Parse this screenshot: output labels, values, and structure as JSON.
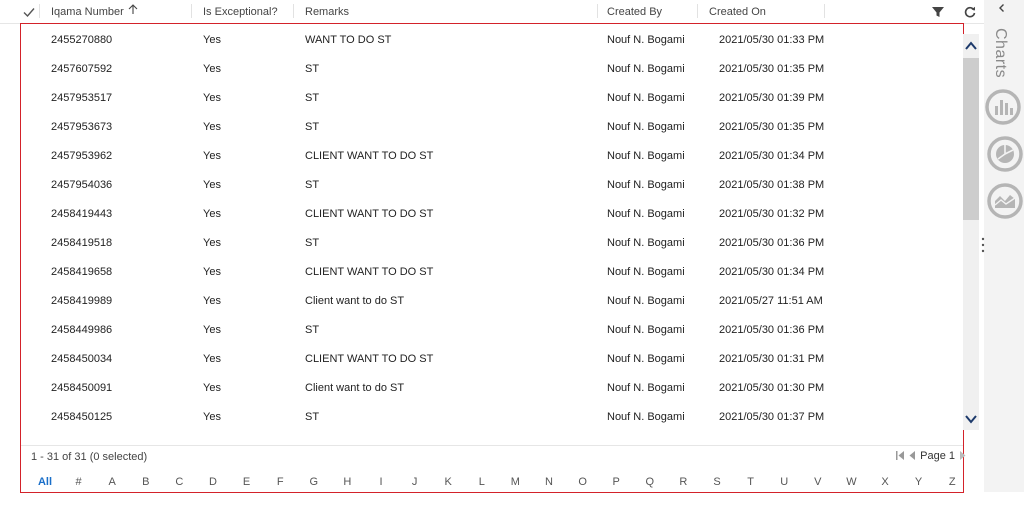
{
  "header": {
    "columns": [
      "Iqama Number",
      "Is Exceptional?",
      "Remarks",
      "Created By",
      "Created On"
    ]
  },
  "rows": [
    {
      "iqama": "2455270880",
      "exceptional": "Yes",
      "remarks": "WANT TO DO ST",
      "created_by": "Nouf N. Bogami",
      "created_on": "2021/05/30 01:33 PM"
    },
    {
      "iqama": "2457607592",
      "exceptional": "Yes",
      "remarks": "ST",
      "created_by": "Nouf N. Bogami",
      "created_on": "2021/05/30 01:35 PM"
    },
    {
      "iqama": "2457953517",
      "exceptional": "Yes",
      "remarks": "ST",
      "created_by": "Nouf N. Bogami",
      "created_on": "2021/05/30 01:39 PM"
    },
    {
      "iqama": "2457953673",
      "exceptional": "Yes",
      "remarks": "ST",
      "created_by": "Nouf N. Bogami",
      "created_on": "2021/05/30 01:35 PM"
    },
    {
      "iqama": "2457953962",
      "exceptional": "Yes",
      "remarks": "CLIENT WANT TO DO ST",
      "created_by": "Nouf N. Bogami",
      "created_on": "2021/05/30 01:34 PM"
    },
    {
      "iqama": "2457954036",
      "exceptional": "Yes",
      "remarks": "ST",
      "created_by": "Nouf N. Bogami",
      "created_on": "2021/05/30 01:38 PM"
    },
    {
      "iqama": "2458419443",
      "exceptional": "Yes",
      "remarks": "CLIENT WANT TO DO ST",
      "created_by": "Nouf N. Bogami",
      "created_on": "2021/05/30 01:32 PM"
    },
    {
      "iqama": "2458419518",
      "exceptional": "Yes",
      "remarks": "ST",
      "created_by": "Nouf N. Bogami",
      "created_on": "2021/05/30 01:36 PM"
    },
    {
      "iqama": "2458419658",
      "exceptional": "Yes",
      "remarks": "CLIENT WANT TO DO ST",
      "created_by": "Nouf N. Bogami",
      "created_on": "2021/05/30 01:34 PM"
    },
    {
      "iqama": "2458419989",
      "exceptional": "Yes",
      "remarks": "Client want to do ST",
      "created_by": "Nouf N. Bogami",
      "created_on": "2021/05/27 11:51 AM"
    },
    {
      "iqama": "2458449986",
      "exceptional": "Yes",
      "remarks": "ST",
      "created_by": "Nouf N. Bogami",
      "created_on": "2021/05/30 01:36 PM"
    },
    {
      "iqama": "2458450034",
      "exceptional": "Yes",
      "remarks": "CLIENT WANT TO DO ST",
      "created_by": "Nouf N. Bogami",
      "created_on": "2021/05/30 01:31 PM"
    },
    {
      "iqama": "2458450091",
      "exceptional": "Yes",
      "remarks": "Client want to do ST",
      "created_by": "Nouf N. Bogami",
      "created_on": "2021/05/30 01:30 PM"
    },
    {
      "iqama": "2458450125",
      "exceptional": "Yes",
      "remarks": "ST",
      "created_by": "Nouf N. Bogami",
      "created_on": "2021/05/30 01:37 PM"
    }
  ],
  "footer": {
    "status": "1 - 31 of 31 (0 selected)",
    "page_label": "Page 1",
    "alphabet": [
      "All",
      "#",
      "A",
      "B",
      "C",
      "D",
      "E",
      "F",
      "G",
      "H",
      "I",
      "J",
      "K",
      "L",
      "M",
      "N",
      "O",
      "P",
      "Q",
      "R",
      "S",
      "T",
      "U",
      "V",
      "W",
      "X",
      "Y",
      "Z"
    ]
  },
  "side_panel": {
    "title": "Charts",
    "buttons": [
      "bar-chart-icon",
      "pie-chart-icon",
      "area-chart-icon"
    ]
  },
  "colors": {
    "selection_border": "#d3222a",
    "link_blue": "#1a6fc9"
  }
}
